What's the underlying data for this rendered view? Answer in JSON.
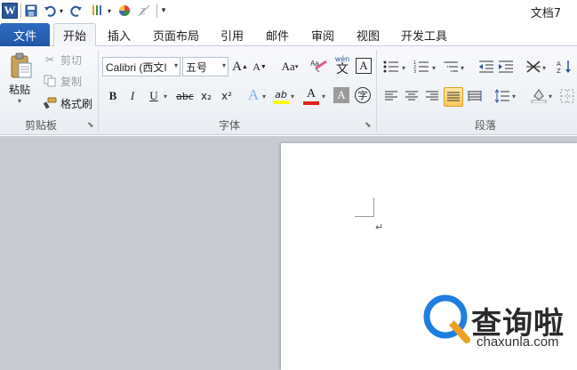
{
  "title_bar": {
    "document_title": "文档7",
    "customize_arrow": "▾"
  },
  "tabs": [
    {
      "label": "文件",
      "active": false
    },
    {
      "label": "开始",
      "active": true
    },
    {
      "label": "插入",
      "active": false
    },
    {
      "label": "页面布局",
      "active": false
    },
    {
      "label": "引用",
      "active": false
    },
    {
      "label": "邮件",
      "active": false
    },
    {
      "label": "审阅",
      "active": false
    },
    {
      "label": "视图",
      "active": false
    },
    {
      "label": "开发工具",
      "active": false
    }
  ],
  "clipboard": {
    "group_label": "剪贴板",
    "paste_label": "粘贴",
    "cut_label": "剪切",
    "copy_label": "复制",
    "format_painter_label": "格式刷"
  },
  "font": {
    "group_label": "字体",
    "font_name": "Calibri (西文I",
    "font_size": "五号",
    "grow_font": "A",
    "shrink_font": "A",
    "change_case": "Aa",
    "wen_label": "wén",
    "wen_char": "文",
    "char_border": "A",
    "bold": "B",
    "italic": "I",
    "underline": "U",
    "strikethrough": "abc",
    "subscript": "x₂",
    "superscript": "x²",
    "text_effect": "A",
    "highlight": "ab",
    "font_color": "A",
    "char_shading": "A",
    "enclose_char": "字"
  },
  "paragraph": {
    "group_label": "段落"
  },
  "document": {
    "paragraph_mark": "↵"
  },
  "watermark": {
    "text": "查询啦",
    "url": "chaxunla.com"
  },
  "colors": {
    "file_tab": "#2f6bc1",
    "highlight_yellow": "#ffff00",
    "font_color_red": "#e02020",
    "selected_button": "#f8c95c",
    "workspace_bg": "#c8ccd2",
    "logo_blue": "#1f7fe0",
    "logo_orange": "#f0a020"
  }
}
